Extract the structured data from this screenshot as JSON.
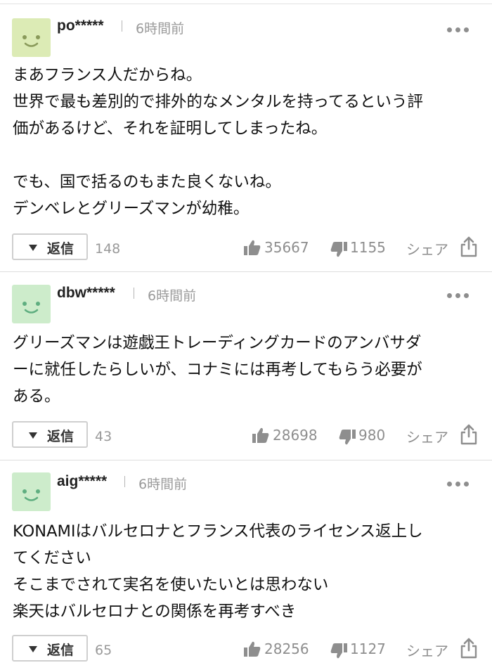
{
  "colors": {
    "avatar_bg": "#d9eab7",
    "avatar_face": "#6fa95c",
    "avatar_bg_alt": "#cfeccc",
    "muted_text": "#999999",
    "divider": "#dedede"
  },
  "comments": [
    {
      "username": "po*****",
      "time": "6時間前",
      "lines": [
        "まあフランス人だからね。",
        "世界で最も差別的で排外的なメンタルを持ってるという評",
        "価があるけど、それを証明してしまったね。",
        "",
        "でも、国で括るのもまた良くないね。",
        "デンベレとグリーズマンが幼稚。"
      ],
      "reply_label": "返信",
      "reply_count": "148",
      "likes": "35667",
      "dislikes": "1155",
      "share_label": "シェア"
    },
    {
      "username": "dbw*****",
      "time": "6時間前",
      "lines": [
        "グリーズマンは遊戯王トレーディングカードのアンバサダ",
        "ーに就任したらしいが、コナミには再考してもらう必要が",
        "ある。"
      ],
      "reply_label": "返信",
      "reply_count": "43",
      "likes": "28698",
      "dislikes": "980",
      "share_label": "シェア"
    },
    {
      "username": "aig*****",
      "time": "6時間前",
      "lines": [
        "KONAMIはバルセロナとフランス代表のライセンス返上し",
        "てください",
        "そこまでされて実名を使いたいとは思わない",
        "楽天はバルセロナとの関係を再考すべき"
      ],
      "reply_label": "返信",
      "reply_count": "65",
      "likes": "28256",
      "dislikes": "1127",
      "share_label": "シェア"
    }
  ],
  "icons": {
    "more": "more-options-icon",
    "like": "thumbs-up-icon",
    "dislike": "thumbs-down-icon",
    "share": "share-icon",
    "reply": "chevron-down-icon",
    "avatar": "smiley-avatar-icon"
  }
}
